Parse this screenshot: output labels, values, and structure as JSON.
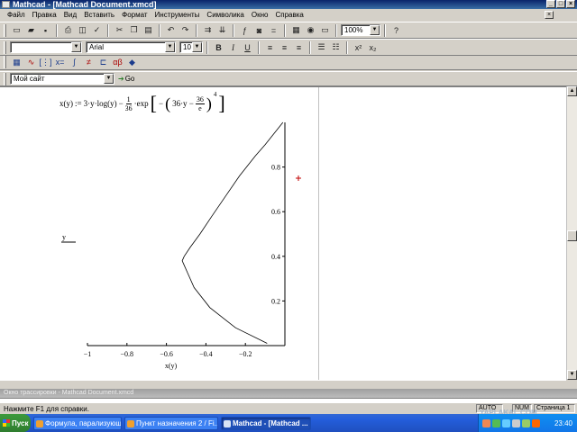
{
  "window": {
    "title": "Mathcad - [Mathcad Document.xmcd]"
  },
  "menu": [
    "Файл",
    "Правка",
    "Вид",
    "Вставить",
    "Формат",
    "Инструменты",
    "Символика",
    "Окно",
    "Справка"
  ],
  "toolbar": {
    "zoom": "100%"
  },
  "format_bar": {
    "style": "",
    "font": "Arial",
    "size": "10",
    "bold": "B",
    "italic": "I",
    "underline": "U"
  },
  "resources": {
    "site": "Мой сайт",
    "go_label": "Go"
  },
  "formula": {
    "lhs": "x(y)",
    "assign": ":=",
    "term1": "3·y·log(y)",
    "minus": "−",
    "frac_num": "1",
    "frac_den": "36",
    "exp": "·exp",
    "inner": "36·y −",
    "inner_frac_num": "36",
    "inner_frac_den": "e",
    "power": "4"
  },
  "chart_data": {
    "type": "line",
    "xlabel": "x(y)",
    "ylabel": "y",
    "xlim": [
      -1,
      0
    ],
    "ylim": [
      0,
      1
    ],
    "xticks": [
      "−1",
      "−0.8",
      "−0.6",
      "−0.4",
      "−0.2"
    ],
    "yticks": [
      "0.2",
      "0.4",
      "0.6",
      "0.8"
    ],
    "series": [
      {
        "points": [
          [
            -0.09,
            0.01
          ],
          [
            -0.25,
            0.08
          ],
          [
            -0.38,
            0.17
          ],
          [
            -0.46,
            0.26
          ],
          [
            -0.49,
            0.32
          ],
          [
            -0.51,
            0.36
          ],
          [
            -0.52,
            0.38
          ],
          [
            -0.51,
            0.4
          ],
          [
            -0.48,
            0.44
          ],
          [
            -0.43,
            0.5
          ],
          [
            -0.37,
            0.58
          ],
          [
            -0.3,
            0.67
          ],
          [
            -0.23,
            0.76
          ],
          [
            -0.15,
            0.85
          ],
          [
            -0.1,
            0.9
          ],
          [
            -0.01,
            1.0
          ]
        ]
      }
    ],
    "color": "#000000",
    "marker_color": "#c00000"
  },
  "trace": {
    "title": "Окно трассировки - Mathcad Document.xmcd"
  },
  "status": {
    "help": "Нажмите F1 для справки.",
    "auto": "AUTO",
    "num": "NUM",
    "page": "Страница 1"
  },
  "taskbar": {
    "start": "Пуск",
    "tasks": [
      {
        "label": "Формула, парализующ...",
        "active": false
      },
      {
        "label": "Пункт назначения 2 / Fi...",
        "active": false
      },
      {
        "label": "Mathcad - [Mathcad ...",
        "active": true
      }
    ],
    "clock": "23:40",
    "watermark": "YAPLAKAL.COM"
  }
}
